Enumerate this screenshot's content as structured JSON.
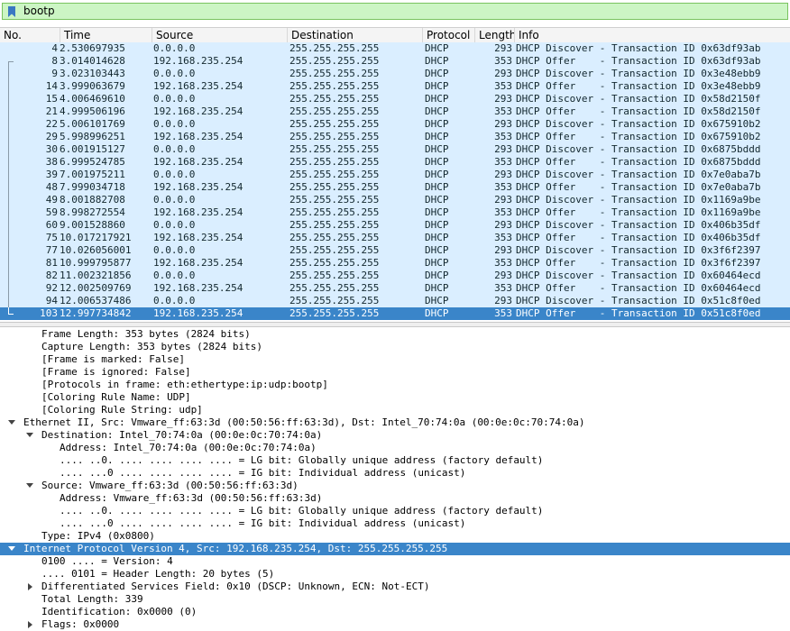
{
  "filter": {
    "value": "bootp"
  },
  "columns": [
    "No.",
    "Time",
    "Source",
    "Destination",
    "Protocol",
    "Length",
    "Info"
  ],
  "packets": [
    {
      "no": "4",
      "time": "2.530697935",
      "src": "0.0.0.0",
      "dst": "255.255.255.255",
      "proto": "DHCP",
      "len": "293",
      "info": "DHCP Discover - Transaction ID 0x63df93ab"
    },
    {
      "no": "8",
      "time": "3.014014628",
      "src": "192.168.235.254",
      "dst": "255.255.255.255",
      "proto": "DHCP",
      "len": "353",
      "info": "DHCP Offer    - Transaction ID 0x63df93ab"
    },
    {
      "no": "9",
      "time": "3.023103443",
      "src": "0.0.0.0",
      "dst": "255.255.255.255",
      "proto": "DHCP",
      "len": "293",
      "info": "DHCP Discover - Transaction ID 0x3e48ebb9"
    },
    {
      "no": "14",
      "time": "3.999063679",
      "src": "192.168.235.254",
      "dst": "255.255.255.255",
      "proto": "DHCP",
      "len": "353",
      "info": "DHCP Offer    - Transaction ID 0x3e48ebb9"
    },
    {
      "no": "15",
      "time": "4.006469610",
      "src": "0.0.0.0",
      "dst": "255.255.255.255",
      "proto": "DHCP",
      "len": "293",
      "info": "DHCP Discover - Transaction ID 0x58d2150f"
    },
    {
      "no": "21",
      "time": "4.999506196",
      "src": "192.168.235.254",
      "dst": "255.255.255.255",
      "proto": "DHCP",
      "len": "353",
      "info": "DHCP Offer    - Transaction ID 0x58d2150f"
    },
    {
      "no": "22",
      "time": "5.006101769",
      "src": "0.0.0.0",
      "dst": "255.255.255.255",
      "proto": "DHCP",
      "len": "293",
      "info": "DHCP Discover - Transaction ID 0x675910b2"
    },
    {
      "no": "29",
      "time": "5.998996251",
      "src": "192.168.235.254",
      "dst": "255.255.255.255",
      "proto": "DHCP",
      "len": "353",
      "info": "DHCP Offer    - Transaction ID 0x675910b2"
    },
    {
      "no": "30",
      "time": "6.001915127",
      "src": "0.0.0.0",
      "dst": "255.255.255.255",
      "proto": "DHCP",
      "len": "293",
      "info": "DHCP Discover - Transaction ID 0x6875bddd"
    },
    {
      "no": "38",
      "time": "6.999524785",
      "src": "192.168.235.254",
      "dst": "255.255.255.255",
      "proto": "DHCP",
      "len": "353",
      "info": "DHCP Offer    - Transaction ID 0x6875bddd"
    },
    {
      "no": "39",
      "time": "7.001975211",
      "src": "0.0.0.0",
      "dst": "255.255.255.255",
      "proto": "DHCP",
      "len": "293",
      "info": "DHCP Discover - Transaction ID 0x7e0aba7b"
    },
    {
      "no": "48",
      "time": "7.999034718",
      "src": "192.168.235.254",
      "dst": "255.255.255.255",
      "proto": "DHCP",
      "len": "353",
      "info": "DHCP Offer    - Transaction ID 0x7e0aba7b"
    },
    {
      "no": "49",
      "time": "8.001882708",
      "src": "0.0.0.0",
      "dst": "255.255.255.255",
      "proto": "DHCP",
      "len": "293",
      "info": "DHCP Discover - Transaction ID 0x1169a9be"
    },
    {
      "no": "59",
      "time": "8.998272554",
      "src": "192.168.235.254",
      "dst": "255.255.255.255",
      "proto": "DHCP",
      "len": "353",
      "info": "DHCP Offer    - Transaction ID 0x1169a9be"
    },
    {
      "no": "60",
      "time": "9.001528860",
      "src": "0.0.0.0",
      "dst": "255.255.255.255",
      "proto": "DHCP",
      "len": "293",
      "info": "DHCP Discover - Transaction ID 0x406b35df"
    },
    {
      "no": "75",
      "time": "10.017217921",
      "src": "192.168.235.254",
      "dst": "255.255.255.255",
      "proto": "DHCP",
      "len": "353",
      "info": "DHCP Offer    - Transaction ID 0x406b35df"
    },
    {
      "no": "77",
      "time": "10.026056001",
      "src": "0.0.0.0",
      "dst": "255.255.255.255",
      "proto": "DHCP",
      "len": "293",
      "info": "DHCP Discover - Transaction ID 0x3f6f2397"
    },
    {
      "no": "81",
      "time": "10.999795877",
      "src": "192.168.235.254",
      "dst": "255.255.255.255",
      "proto": "DHCP",
      "len": "353",
      "info": "DHCP Offer    - Transaction ID 0x3f6f2397"
    },
    {
      "no": "82",
      "time": "11.002321856",
      "src": "0.0.0.0",
      "dst": "255.255.255.255",
      "proto": "DHCP",
      "len": "293",
      "info": "DHCP Discover - Transaction ID 0x60464ecd"
    },
    {
      "no": "92",
      "time": "12.002509769",
      "src": "192.168.235.254",
      "dst": "255.255.255.255",
      "proto": "DHCP",
      "len": "353",
      "info": "DHCP Offer    - Transaction ID 0x60464ecd"
    },
    {
      "no": "94",
      "time": "12.006537486",
      "src": "0.0.0.0",
      "dst": "255.255.255.255",
      "proto": "DHCP",
      "len": "293",
      "info": "DHCP Discover - Transaction ID 0x51c8f0ed"
    },
    {
      "no": "103",
      "time": "12.997734842",
      "src": "192.168.235.254",
      "dst": "255.255.255.255",
      "proto": "DHCP",
      "len": "353",
      "info": "DHCP Offer    - Transaction ID 0x51c8f0ed",
      "selected": true
    }
  ],
  "details": [
    {
      "text": "Frame Length: 353 bytes (2824 bits)",
      "indent": 1
    },
    {
      "text": "Capture Length: 353 bytes (2824 bits)",
      "indent": 1
    },
    {
      "text": "[Frame is marked: False]",
      "indent": 1
    },
    {
      "text": "[Frame is ignored: False]",
      "indent": 1
    },
    {
      "text": "[Protocols in frame: eth:ethertype:ip:udp:bootp]",
      "indent": 1
    },
    {
      "text": "[Coloring Rule Name: UDP]",
      "indent": 1
    },
    {
      "text": "[Coloring Rule String: udp]",
      "indent": 1
    },
    {
      "text": "Ethernet II, Src: Vmware_ff:63:3d (00:50:56:ff:63:3d), Dst: Intel_70:74:0a (00:0e:0c:70:74:0a)",
      "indent": 0,
      "arrow": "down"
    },
    {
      "text": "Destination: Intel_70:74:0a (00:0e:0c:70:74:0a)",
      "indent": 1,
      "arrow": "down"
    },
    {
      "text": "Address: Intel_70:74:0a (00:0e:0c:70:74:0a)",
      "indent": 2
    },
    {
      "text": ".... ..0. .... .... .... .... = LG bit: Globally unique address (factory default)",
      "indent": 2
    },
    {
      "text": ".... ...0 .... .... .... .... = IG bit: Individual address (unicast)",
      "indent": 2
    },
    {
      "text": "Source: Vmware_ff:63:3d (00:50:56:ff:63:3d)",
      "indent": 1,
      "arrow": "down"
    },
    {
      "text": "Address: Vmware_ff:63:3d (00:50:56:ff:63:3d)",
      "indent": 2
    },
    {
      "text": ".... ..0. .... .... .... .... = LG bit: Globally unique address (factory default)",
      "indent": 2
    },
    {
      "text": ".... ...0 .... .... .... .... = IG bit: Individual address (unicast)",
      "indent": 2
    },
    {
      "text": "Type: IPv4 (0x0800)",
      "indent": 1
    },
    {
      "text": "Internet Protocol Version 4, Src: 192.168.235.254, Dst: 255.255.255.255",
      "indent": 0,
      "arrow": "down",
      "selected": true
    },
    {
      "text": "0100 .... = Version: 4",
      "indent": 1
    },
    {
      "text": ".... 0101 = Header Length: 20 bytes (5)",
      "indent": 1
    },
    {
      "text": "Differentiated Services Field: 0x10 (DSCP: Unknown, ECN: Not-ECT)",
      "indent": 1,
      "arrow": "right"
    },
    {
      "text": "Total Length: 339",
      "indent": 1
    },
    {
      "text": "Identification: 0x0000 (0)",
      "indent": 1
    },
    {
      "text": "Flags: 0x0000",
      "indent": 1,
      "arrow": "right"
    }
  ],
  "colors": {
    "row_bg": "#daeeff",
    "selected_bg": "#3a85c9",
    "filter_bg": "#ccf5c4"
  }
}
